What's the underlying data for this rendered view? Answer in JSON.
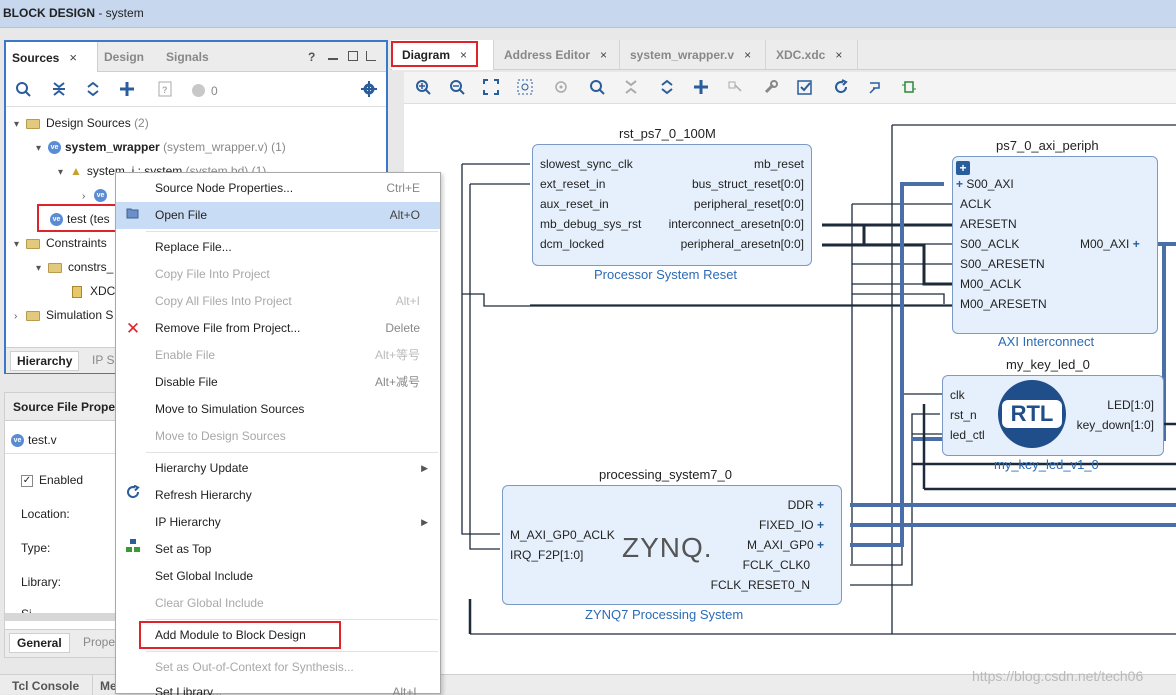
{
  "titlebar": {
    "title_bold": "BLOCK DESIGN",
    "title_rest": " - system"
  },
  "left_tabs": {
    "sources": "Sources",
    "design": "Design",
    "signals": "Signals",
    "close": "×",
    "help": "?"
  },
  "left_toolbar": {
    "count": "0"
  },
  "tree": {
    "design_sources": "Design Sources",
    "design_sources_count": "(2)",
    "system_wrapper": "system_wrapper",
    "system_wrapper_file": "(system_wrapper.v) (1)",
    "system_i": "system_i : system",
    "system_i_file": "(system.bd) (1)",
    "ve": "ve",
    "test": "test (tes",
    "constraints": "Constraints",
    "constrs": "constrs_",
    "xdc": "XDC",
    "simulation": "Simulation S"
  },
  "left_bottom_tabs": {
    "hierarchy": "Hierarchy",
    "ip": "IP S"
  },
  "props": {
    "header": "Source File Proper",
    "file": "test.v",
    "enabled": "Enabled",
    "location": "Location:",
    "type": "Type:",
    "library": "Library:",
    "size": "Si",
    "tab_general": "General",
    "tab_properties": "Prope"
  },
  "bottom_bar": {
    "tcl": "Tcl Console",
    "me": "Me"
  },
  "right_tabs": [
    {
      "label": "Diagram"
    },
    {
      "label": "Address Editor"
    },
    {
      "label": "system_wrapper.v"
    },
    {
      "label": "XDC.xdc"
    }
  ],
  "context_menu": [
    {
      "label": "Source Node Properties...",
      "shortcut": "Ctrl+E",
      "state": "normal",
      "icon": ""
    },
    {
      "label": "Open File",
      "shortcut": "Alt+O",
      "state": "selected",
      "icon": "folder-open-icon"
    },
    {
      "label": "Replace File...",
      "shortcut": "",
      "state": "normal",
      "icon": ""
    },
    {
      "label": "Copy File Into Project",
      "shortcut": "",
      "state": "disabled",
      "icon": ""
    },
    {
      "label": "Copy All Files Into Project",
      "shortcut": "Alt+I",
      "state": "disabled",
      "icon": ""
    },
    {
      "label": "Remove File from Project...",
      "shortcut": "Delete",
      "state": "normal",
      "icon": "remove-icon"
    },
    {
      "label": "Enable File",
      "shortcut": "Alt+等号",
      "state": "disabled",
      "icon": ""
    },
    {
      "label": "Disable File",
      "shortcut": "Alt+减号",
      "state": "normal",
      "icon": ""
    },
    {
      "label": "Move to Simulation Sources",
      "shortcut": "",
      "state": "normal",
      "icon": ""
    },
    {
      "label": "Move to Design Sources",
      "shortcut": "",
      "state": "disabled",
      "icon": ""
    },
    {
      "label": "Hierarchy Update",
      "shortcut": "",
      "state": "submenu",
      "icon": ""
    },
    {
      "label": "Refresh Hierarchy",
      "shortcut": "",
      "state": "normal",
      "icon": "refresh-icon"
    },
    {
      "label": "IP Hierarchy",
      "shortcut": "",
      "state": "submenu",
      "icon": ""
    },
    {
      "label": "Set as Top",
      "shortcut": "",
      "state": "normal",
      "icon": "set-top-icon"
    },
    {
      "label": "Set Global Include",
      "shortcut": "",
      "state": "normal",
      "icon": ""
    },
    {
      "label": "Clear Global Include",
      "shortcut": "",
      "state": "disabled",
      "icon": ""
    },
    {
      "label": "Add Module to Block Design",
      "shortcut": "",
      "state": "normal",
      "icon": ""
    },
    {
      "label": "Set as Out-of-Context for Synthesis...",
      "shortcut": "",
      "state": "disabled",
      "icon": ""
    },
    {
      "label": "Set Library...",
      "shortcut": "Alt+L",
      "state": "normal",
      "icon": ""
    }
  ],
  "diagram": {
    "rst": {
      "title": "rst_ps7_0_100M",
      "sub": "Processor System Reset",
      "in_pins": [
        "slowest_sync_clk",
        "ext_reset_in",
        "aux_reset_in",
        "mb_debug_sys_rst",
        "dcm_locked"
      ],
      "out_pins": [
        "mb_reset",
        "bus_struct_reset[0:0]",
        "peripheral_reset[0:0]",
        "interconnect_aresetn[0:0]",
        "peripheral_aresetn[0:0]"
      ]
    },
    "axi": {
      "title": "ps7_0_axi_periph",
      "sub": "AXI Interconnect",
      "plus": "+",
      "in_pins": [
        "S00_AXI",
        "ACLK",
        "ARESETN",
        "S00_ACLK",
        "S00_ARESETN",
        "M00_ACLK",
        "M00_ARESETN"
      ],
      "out_pin": "M00_AXI"
    },
    "key": {
      "title": "my_key_led_0",
      "sub": "my_key_led_v1_0",
      "logo": "RTL",
      "in_pins": [
        "clk",
        "rst_n",
        "led_ctl"
      ],
      "out_pins": [
        "LED[1:0]",
        "key_down[1:0]"
      ]
    },
    "ps7": {
      "title": "processing_system7_0",
      "sub": "ZYNQ7 Processing System",
      "logo": "ZYNQ.",
      "in_pins": [
        "M_AXI_GP0_ACLK",
        "IRQ_F2P[1:0]"
      ],
      "out_pins": [
        "DDR",
        "FIXED_IO",
        "M_AXI_GP0",
        "FCLK_CLK0",
        "FCLK_RESET0_N"
      ]
    }
  },
  "watermark": "https://blog.csdn.net/tech06",
  "colors": {
    "highlight_red": "#e0222a",
    "panel_blue": "#3c78c8",
    "block_fill": "#e6f0fc",
    "bus_blue": "#4a6fa8"
  }
}
